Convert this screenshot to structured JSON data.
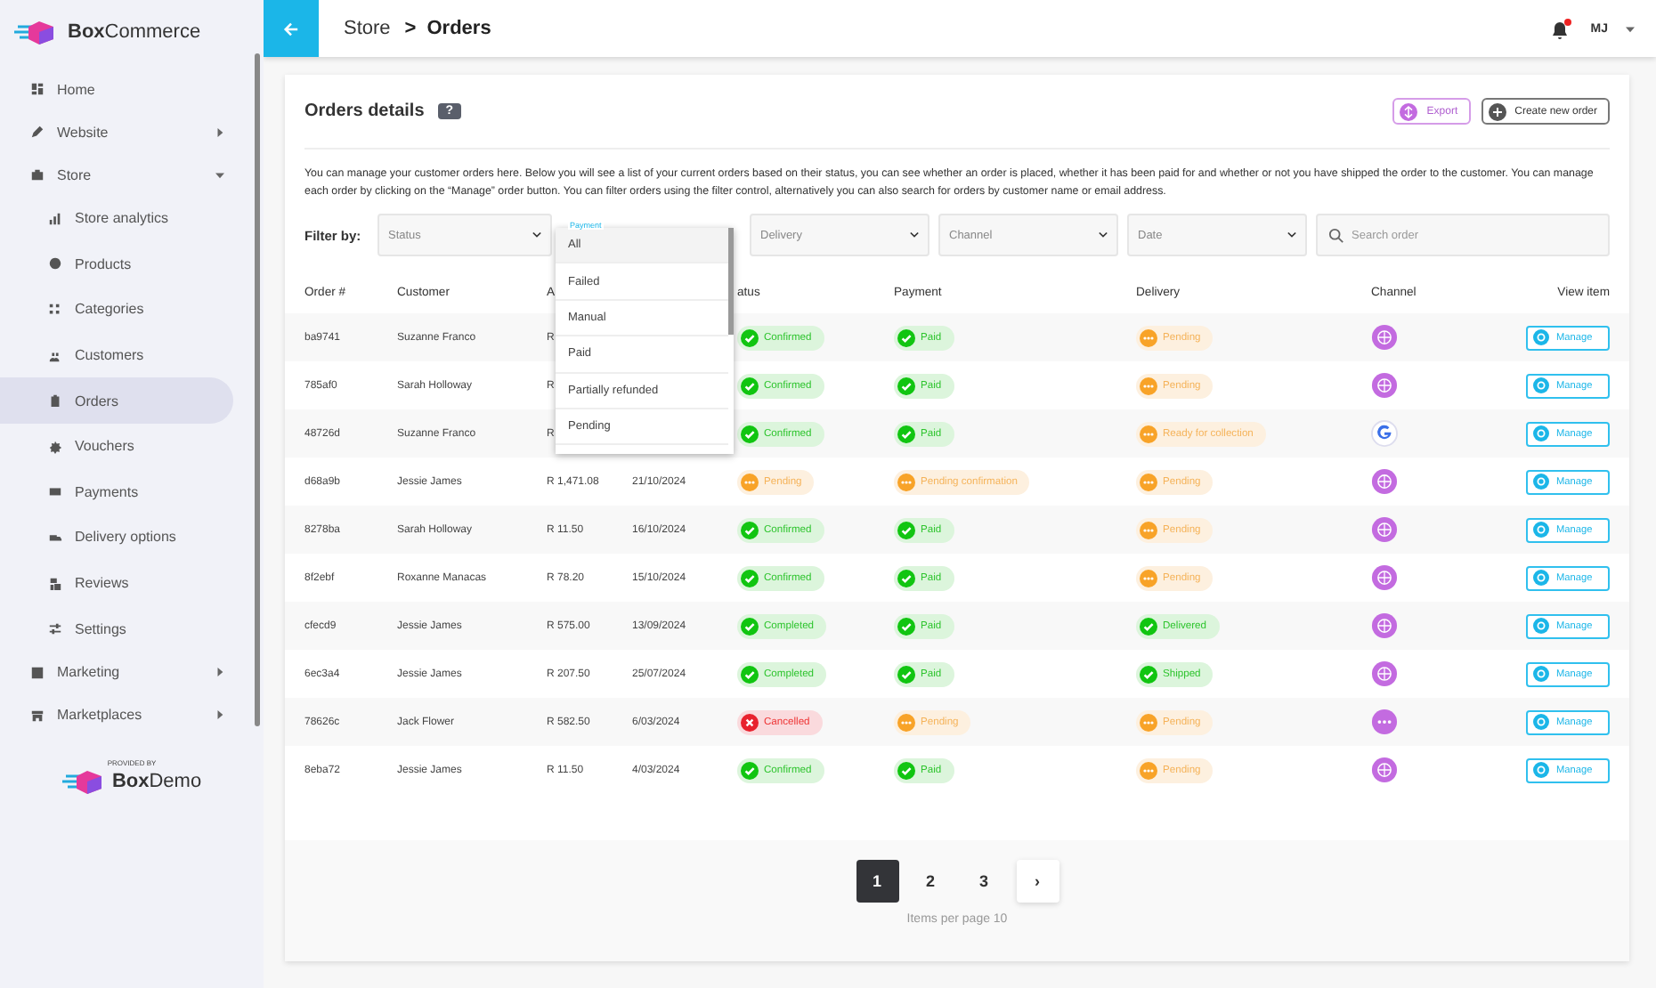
{
  "brand": {
    "name_bold": "Box",
    "name_rest": "Commerce",
    "provided_by": "PROVIDED BY",
    "demo_bold": "Box",
    "demo_rest": "Demo"
  },
  "sidebar": {
    "items": [
      {
        "label": "Home",
        "selected": false
      },
      {
        "label": "Website",
        "selected": false,
        "expanded": false
      },
      {
        "label": "Store",
        "selected": false,
        "expanded": true,
        "children": [
          {
            "label": "Store analytics",
            "selected": false
          },
          {
            "label": "Products",
            "selected": false
          },
          {
            "label": "Categories",
            "selected": false
          },
          {
            "label": "Customers",
            "selected": false
          },
          {
            "label": "Orders",
            "selected": true
          },
          {
            "label": "Vouchers",
            "selected": false
          },
          {
            "label": "Payments",
            "selected": false
          },
          {
            "label": "Delivery options",
            "selected": false
          },
          {
            "label": "Reviews",
            "selected": false
          },
          {
            "label": "Settings",
            "selected": false
          }
        ]
      },
      {
        "label": "Marketing",
        "selected": false,
        "expanded": false
      },
      {
        "label": "Marketplaces",
        "selected": false,
        "expanded": false
      }
    ]
  },
  "topbar": {
    "breadcrumb": [
      "Store",
      "Orders"
    ],
    "separator": ">",
    "user_initials": "MJ",
    "notification": true
  },
  "card": {
    "title": "Orders details",
    "help": "?",
    "export": "Export",
    "create": "Create new order",
    "description": "You can manage your customer orders here. Below you will see a list of your current orders based on their status, you can see whether an order is placed, whether it has been paid for and whether or not you have shipped the order to the customer. You can manage each order by clicking on the “Manage” order button. You can filter orders using the filter control, alternatively you can also search for orders by customer name or email address."
  },
  "filters": {
    "label": "Filter by:",
    "selects": [
      {
        "placeholder": "Status",
        "open": false
      },
      {
        "placeholder": "Payment",
        "open": true,
        "options": [
          {
            "label": "All",
            "selected": true
          },
          {
            "label": "Failed",
            "selected": false
          },
          {
            "label": "Manual",
            "selected": false
          },
          {
            "label": "Paid",
            "selected": false
          },
          {
            "label": "Partially refunded",
            "selected": false
          },
          {
            "label": "Pending",
            "selected": false
          }
        ]
      },
      {
        "placeholder": "Delivery",
        "open": false
      },
      {
        "placeholder": "Channel",
        "open": false
      },
      {
        "placeholder": "Date",
        "open": false
      }
    ],
    "search": {
      "placeholder": "Search order"
    }
  },
  "table": {
    "columns": [
      "Order #",
      "Customer",
      "A",
      "",
      "atus",
      "Payment",
      "Delivery",
      "Channel",
      "View item"
    ],
    "rows": [
      {
        "order": "ba9741",
        "customer": "Suzanne Franco",
        "amount": "R",
        "date": "",
        "status": {
          "label": "Confirmed",
          "kind": "success"
        },
        "payment": {
          "label": "Paid",
          "kind": "success"
        },
        "delivery": {
          "label": "Pending",
          "kind": "pending"
        },
        "channel": {
          "kind": "web"
        },
        "action": "Manage"
      },
      {
        "order": "785af0",
        "customer": "Sarah Holloway",
        "amount": "R",
        "date": "",
        "status": {
          "label": "Confirmed",
          "kind": "success"
        },
        "payment": {
          "label": "Paid",
          "kind": "success"
        },
        "delivery": {
          "label": "Pending",
          "kind": "pending"
        },
        "channel": {
          "kind": "web"
        },
        "action": "Manage"
      },
      {
        "order": "48726d",
        "customer": "Suzanne Franco",
        "amount": "R",
        "date": "",
        "status": {
          "label": "Confirmed",
          "kind": "success"
        },
        "payment": {
          "label": "Paid",
          "kind": "success"
        },
        "delivery": {
          "label": "Ready for collection",
          "kind": "pending"
        },
        "channel": {
          "kind": "google"
        },
        "action": "Manage"
      },
      {
        "order": "d68a9b",
        "customer": "Jessie James",
        "amount": "R 1,471.08",
        "date": "21/10/2024",
        "status": {
          "label": "Pending",
          "kind": "pending"
        },
        "payment": {
          "label": "Pending confirmation",
          "kind": "pending"
        },
        "delivery": {
          "label": "Pending",
          "kind": "pending"
        },
        "channel": {
          "kind": "web"
        },
        "action": "Manage"
      },
      {
        "order": "8278ba",
        "customer": "Sarah Holloway",
        "amount": "R 11.50",
        "date": "16/10/2024",
        "status": {
          "label": "Confirmed",
          "kind": "success"
        },
        "payment": {
          "label": "Paid",
          "kind": "success"
        },
        "delivery": {
          "label": "Pending",
          "kind": "pending"
        },
        "channel": {
          "kind": "web"
        },
        "action": "Manage"
      },
      {
        "order": "8f2ebf",
        "customer": "Roxanne Manacas",
        "amount": "R 78.20",
        "date": "15/10/2024",
        "status": {
          "label": "Confirmed",
          "kind": "success"
        },
        "payment": {
          "label": "Paid",
          "kind": "success"
        },
        "delivery": {
          "label": "Pending",
          "kind": "pending"
        },
        "channel": {
          "kind": "web"
        },
        "action": "Manage"
      },
      {
        "order": "cfecd9",
        "customer": "Jessie James",
        "amount": "R 575.00",
        "date": "13/09/2024",
        "status": {
          "label": "Completed",
          "kind": "success"
        },
        "payment": {
          "label": "Paid",
          "kind": "success"
        },
        "delivery": {
          "label": "Delivered",
          "kind": "success"
        },
        "channel": {
          "kind": "web"
        },
        "action": "Manage"
      },
      {
        "order": "6ec3a4",
        "customer": "Jessie James",
        "amount": "R 207.50",
        "date": "25/07/2024",
        "status": {
          "label": "Completed",
          "kind": "success"
        },
        "payment": {
          "label": "Paid",
          "kind": "success"
        },
        "delivery": {
          "label": "Shipped",
          "kind": "success"
        },
        "channel": {
          "kind": "web"
        },
        "action": "Manage"
      },
      {
        "order": "78626c",
        "customer": "Jack Flower",
        "amount": "R 582.50",
        "date": "6/03/2024",
        "status": {
          "label": "Cancelled",
          "kind": "error"
        },
        "payment": {
          "label": "Pending",
          "kind": "pending"
        },
        "delivery": {
          "label": "Pending",
          "kind": "pending"
        },
        "channel": {
          "kind": "other"
        },
        "action": "Manage"
      },
      {
        "order": "8eba72",
        "customer": "Jessie James",
        "amount": "R 11.50",
        "date": "4/03/2024",
        "status": {
          "label": "Confirmed",
          "kind": "success"
        },
        "payment": {
          "label": "Paid",
          "kind": "success"
        },
        "delivery": {
          "label": "Pending",
          "kind": "pending"
        },
        "channel": {
          "kind": "web"
        },
        "action": "Manage"
      }
    ]
  },
  "pagination": {
    "pages": [
      {
        "label": "1",
        "selected": true
      },
      {
        "label": "2",
        "selected": false
      },
      {
        "label": "3",
        "selected": false
      }
    ],
    "next": "›",
    "items_per_page": "Items per page 10"
  }
}
